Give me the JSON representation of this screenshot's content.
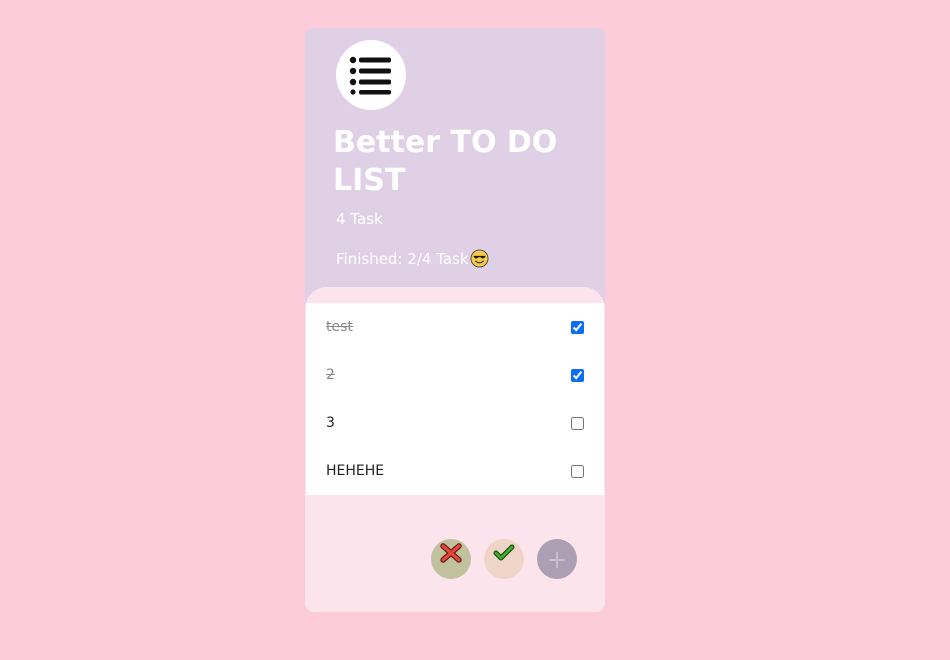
{
  "app": {
    "title": "Better TO DO LIST",
    "task_count": "4 Task",
    "finished_text": "Finished: 2/4 Task",
    "finished_emoji": "smiling-face-with-sunglasses-icon"
  },
  "tasks": [
    {
      "label": "test",
      "done": true
    },
    {
      "label": "2",
      "done": true
    },
    {
      "label": "3",
      "done": false
    },
    {
      "label": "HEHEHE",
      "done": false
    }
  ],
  "actions": {
    "delete_icon": "cross-mark-icon",
    "complete_icon": "check-mark-icon",
    "add_icon": "plus-icon"
  },
  "colors": {
    "page_background": "#fccbd9",
    "header_background": "#dfd0e5",
    "card_background": "#fce4ec",
    "checkbox_accent": "#0b6df2"
  }
}
